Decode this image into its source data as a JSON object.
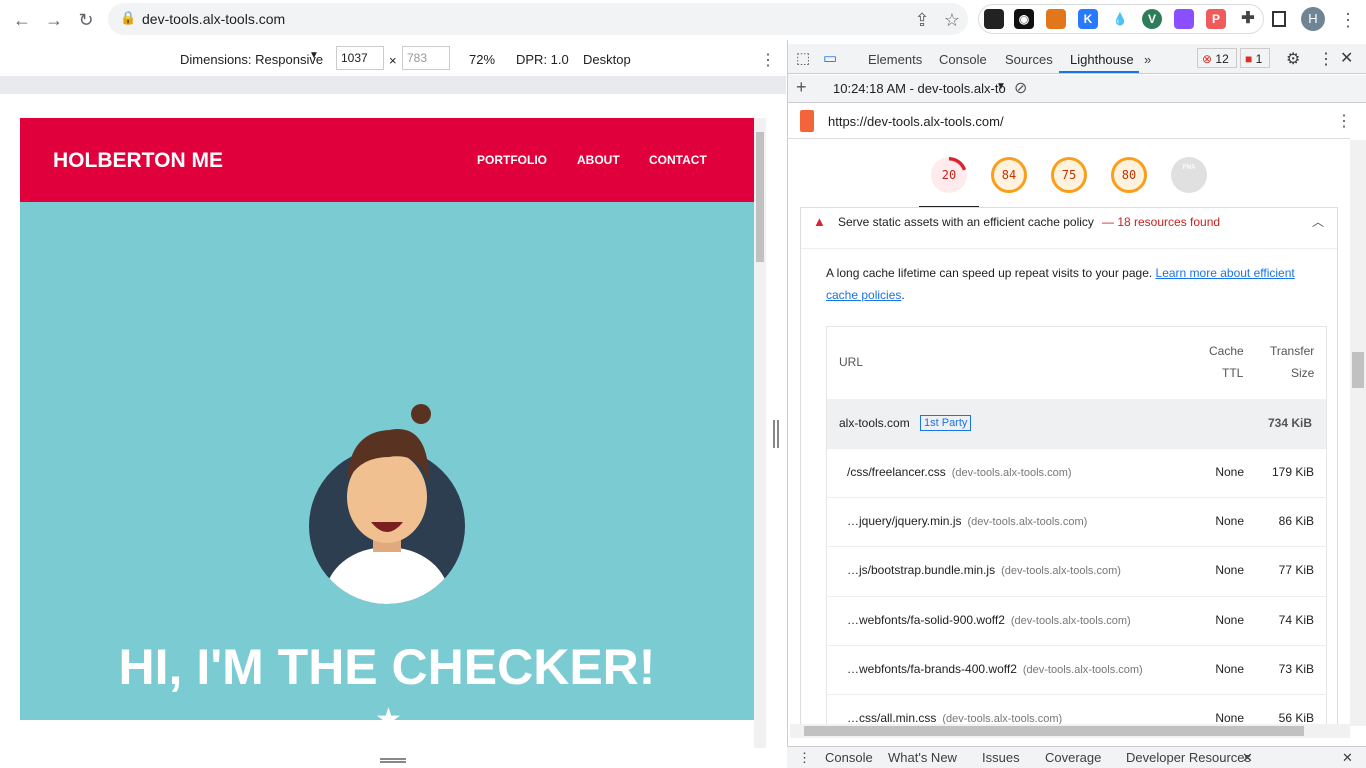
{
  "browser": {
    "url": "dev-tools.alx-tools.com",
    "avatar": "H"
  },
  "device_toolbar": {
    "dimensions": "Dimensions: Responsive",
    "width": "1037",
    "height": "783",
    "zoom": "72%",
    "dpr": "DPR: 1.0",
    "mode": "Desktop",
    "times": "×"
  },
  "site": {
    "brand": "HOLBERTON ME",
    "nav": [
      "PORTFOLIO",
      "ABOUT",
      "CONTACT"
    ],
    "headline": "HI, I'M THE CHECKER!"
  },
  "devtools": {
    "tabs": [
      "Elements",
      "Console",
      "Sources",
      "Lighthouse"
    ],
    "active_tab": "Lighthouse",
    "errors": "12",
    "issues": "1",
    "report": "10:24:18 AM - dev-tools.alx-to",
    "report_url": "https://dev-tools.alx-tools.com/",
    "scores": [
      {
        "value": "20",
        "color": "#e0202c",
        "fraction": 0.2
      },
      {
        "value": "84",
        "color": "#fa9f1b",
        "fraction": 0.84
      },
      {
        "value": "75",
        "color": "#fa9f1b",
        "fraction": 0.75
      },
      {
        "value": "80",
        "color": "#fa9f1b",
        "fraction": 0.8
      }
    ],
    "pwa": "PWA",
    "audit": {
      "title": "Serve static assets with an efficient cache policy",
      "summary": "— 18 resources found",
      "desc": "A long cache lifetime can speed up repeat visits to your page. ",
      "link": "Learn more about efficient cache policies",
      "period": ".",
      "headers": {
        "url": "URL",
        "ttl1": "Cache",
        "ttl2": "TTL",
        "size1": "Transfer",
        "size2": "Size"
      },
      "group": {
        "name": "alx-tools.com",
        "badge": "1st Party",
        "size": "734 KiB"
      },
      "rows": [
        {
          "url": "/css/freelancer.css",
          "host": "(dev-tools.alx-tools.com)",
          "ttl": "None",
          "size": "179 KiB"
        },
        {
          "url": "…jquery/jquery.min.js",
          "host": "(dev-tools.alx-tools.com)",
          "ttl": "None",
          "size": "86 KiB"
        },
        {
          "url": "…js/bootstrap.bundle.min.js",
          "host": "(dev-tools.alx-tools.com)",
          "ttl": "None",
          "size": "77 KiB"
        },
        {
          "url": "…webfonts/fa-solid-900.woff2",
          "host": "(dev-tools.alx-tools.com)",
          "ttl": "None",
          "size": "74 KiB"
        },
        {
          "url": "…webfonts/fa-brands-400.woff2",
          "host": "(dev-tools.alx-tools.com)",
          "ttl": "None",
          "size": "73 KiB"
        },
        {
          "url": "…css/all.min.css",
          "host": "(dev-tools.alx-tools.com)",
          "ttl": "None",
          "size": "56 KiB"
        }
      ]
    },
    "drawer": [
      "Console",
      "What's New",
      "Issues",
      "Coverage",
      "Developer Resources"
    ]
  }
}
